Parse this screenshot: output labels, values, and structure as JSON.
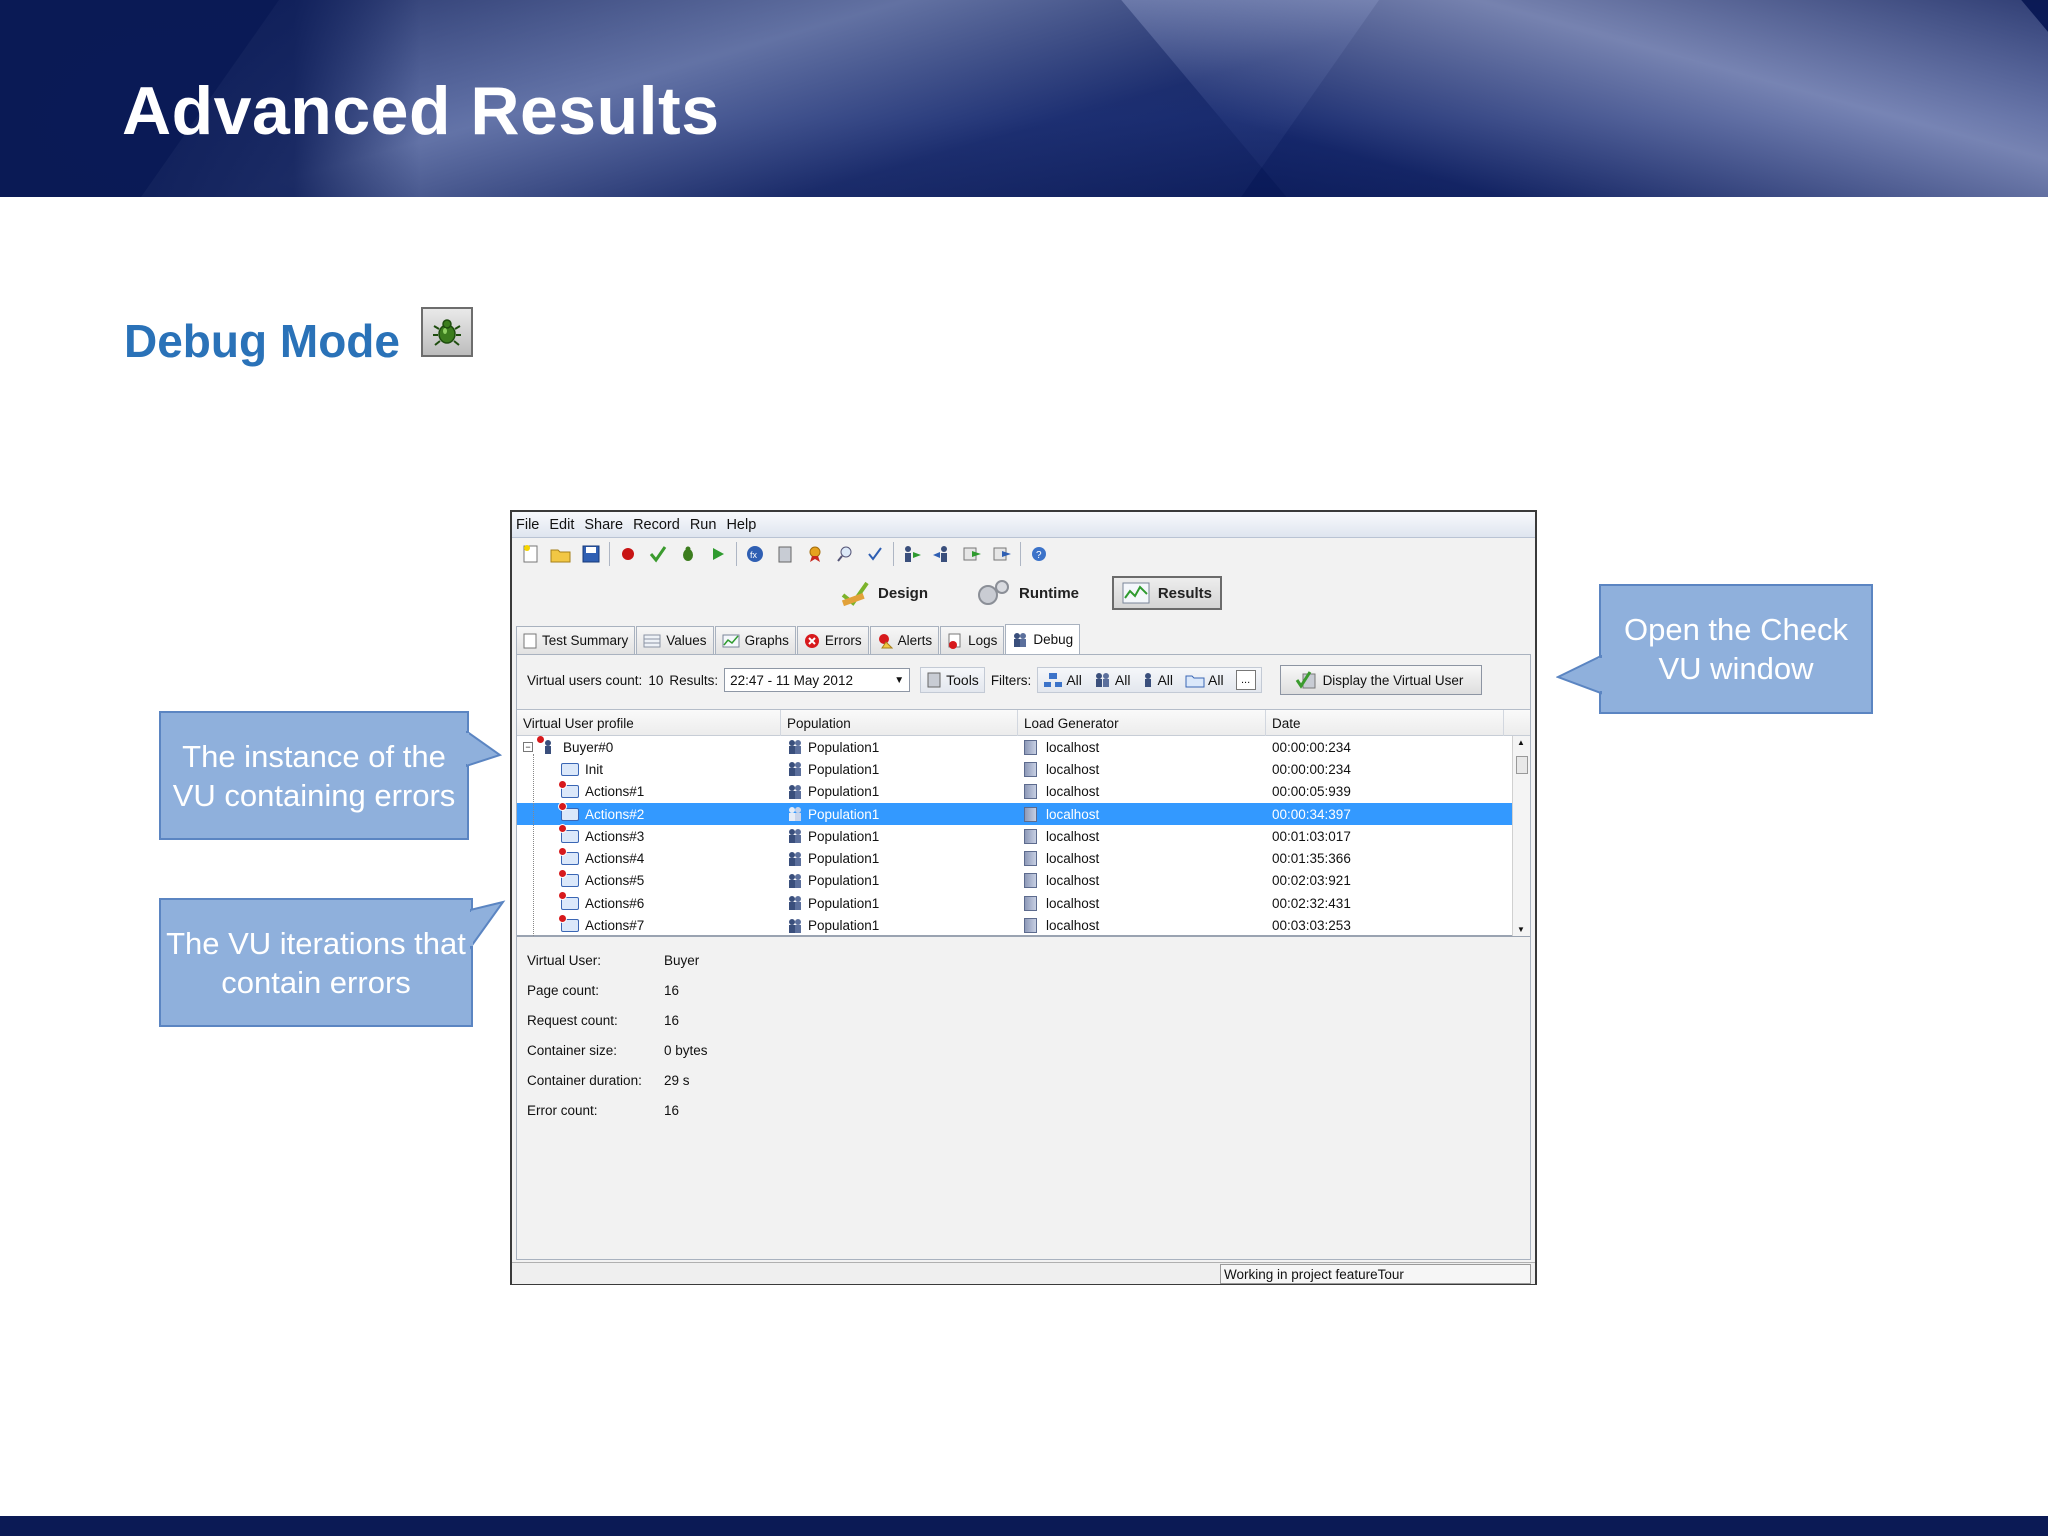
{
  "slide": {
    "title": "Advanced Results",
    "subtitle": "Debug Mode"
  },
  "callouts": {
    "instance": "The instance of the VU containing errors",
    "iterations": "The VU iterations that contain errors",
    "check_vu": "Open the Check VU window"
  },
  "app": {
    "menu": [
      "File",
      "Edit",
      "Share",
      "Record",
      "Run",
      "Help"
    ],
    "modes": {
      "design": "Design",
      "runtime": "Runtime",
      "results": "Results"
    },
    "tabs": [
      "Test Summary",
      "Values",
      "Graphs",
      "Errors",
      "Alerts",
      "Logs",
      "Debug"
    ],
    "filterbar": {
      "vu_count_label": "Virtual users count:",
      "vu_count": "10",
      "results_label": "Results:",
      "results_value": "22:47 - 11 May 2012",
      "tools": "Tools",
      "filters_label": "Filters:",
      "filter_all": "All",
      "more": "...",
      "display_vu": "Display the Virtual User"
    },
    "table": {
      "columns": [
        "Virtual User profile",
        "Population",
        "Load Generator",
        "Date"
      ],
      "rows": [
        {
          "name": "Buyer#0",
          "population": "Population1",
          "lg": "localhost",
          "date": "00:00:00:234"
        },
        {
          "name": "Init",
          "population": "Population1",
          "lg": "localhost",
          "date": "00:00:00:234"
        },
        {
          "name": "Actions#1",
          "population": "Population1",
          "lg": "localhost",
          "date": "00:00:05:939"
        },
        {
          "name": "Actions#2",
          "population": "Population1",
          "lg": "localhost",
          "date": "00:00:34:397"
        },
        {
          "name": "Actions#3",
          "population": "Population1",
          "lg": "localhost",
          "date": "00:01:03:017"
        },
        {
          "name": "Actions#4",
          "population": "Population1",
          "lg": "localhost",
          "date": "00:01:35:366"
        },
        {
          "name": "Actions#5",
          "population": "Population1",
          "lg": "localhost",
          "date": "00:02:03:921"
        },
        {
          "name": "Actions#6",
          "population": "Population1",
          "lg": "localhost",
          "date": "00:02:32:431"
        },
        {
          "name": "Actions#7",
          "population": "Population1",
          "lg": "localhost",
          "date": "00:03:03:253"
        }
      ]
    },
    "details": {
      "virtual_user_label": "Virtual User:",
      "virtual_user": "Buyer",
      "page_count_label": "Page count:",
      "page_count": "16",
      "request_count_label": "Request count:",
      "request_count": "16",
      "container_size_label": "Container size:",
      "container_size": "0 bytes",
      "container_duration_label": "Container duration:",
      "container_duration": "29 s",
      "error_count_label": "Error count:",
      "error_count": "16"
    },
    "status": "Working in project featureTour"
  },
  "colors": {
    "header_bg": "#0d1f63",
    "subtitle": "#2a72b8",
    "callout_fill": "#8fb0dc",
    "selection": "#3399ff"
  }
}
